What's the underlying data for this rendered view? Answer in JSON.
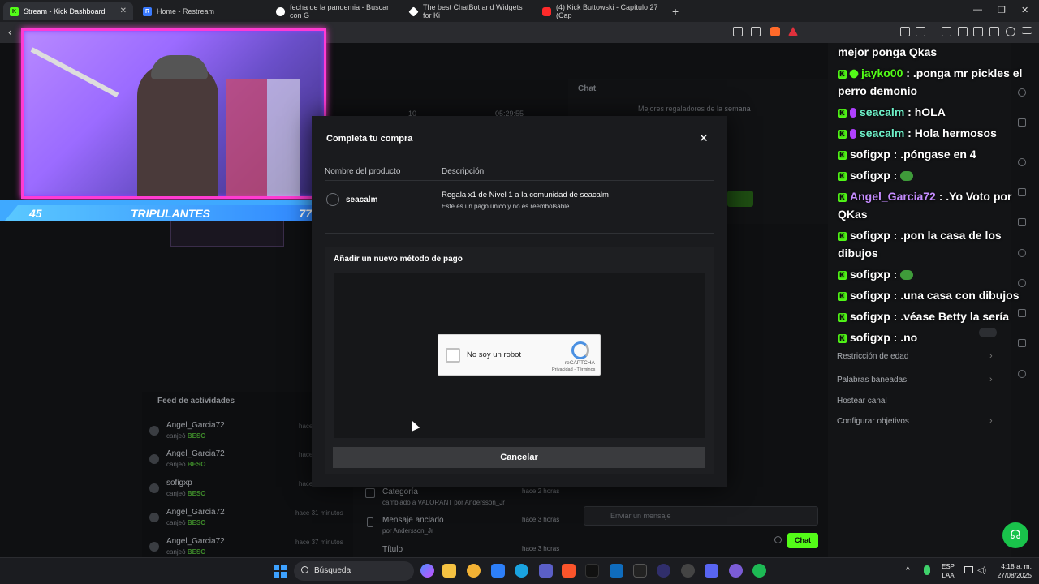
{
  "browser": {
    "tabs": [
      {
        "label": "Stream - Kick Dashboard",
        "active": true,
        "icon": "kick-icon"
      },
      {
        "label": "Home - Restream",
        "icon": "restream-icon"
      },
      {
        "label": "fecha de la pandemia - Buscar con G",
        "icon": "google-icon"
      },
      {
        "label": "The best ChatBot and Widgets for Ki",
        "icon": "botrix-icon"
      },
      {
        "label": "(4) Kick Buttowski - Capítulo 27 (Cap",
        "icon": "youtube-icon"
      }
    ]
  },
  "webcam": {
    "left_count": "45",
    "label": "TRIPULANTES",
    "right_count": "77"
  },
  "dashboard": {
    "chat_title": "Chat",
    "leaders_title": "Mejores regaladores de la semana",
    "stat1": "10",
    "stat2": "05:29:55",
    "feed_title": "Feed de actividades",
    "feed": [
      {
        "name": "Angel_Garcia72",
        "action": "canjeó",
        "item": "BESO",
        "time": "hace"
      },
      {
        "name": "Angel_Garcia72",
        "action": "canjeó",
        "item": "BESO",
        "time": "hace"
      },
      {
        "name": "sofigxp",
        "action": "canjeó",
        "item": "BESO",
        "time": "hace"
      },
      {
        "name": "Angel_Garcia72",
        "action": "canjeó",
        "item": "BESO",
        "time": "hace 31 minutos"
      },
      {
        "name": "Angel_Garcia72",
        "action": "canjeó",
        "item": "BESO",
        "time": "hace 37 minutos"
      }
    ],
    "events": [
      {
        "title": "Categoría",
        "sub": "cambiado a VALORANT por Andersson_Jr",
        "time": "hace 2 horas"
      },
      {
        "title": "Mensaje anclado",
        "sub": "por Andersson_Jr",
        "time": "hace 3 horas"
      },
      {
        "title": "Título",
        "time": "hace 3 horas"
      }
    ],
    "chat_input_placeholder": "Enviar un mensaje",
    "chat_button": "Chat"
  },
  "settings": [
    {
      "label": "Restricción de edad",
      "chevron": true
    },
    {
      "label": "Palabras baneadas",
      "chevron": true
    },
    {
      "label": "Hostear canal",
      "chevron": false
    },
    {
      "label": "Configurar objetivos",
      "chevron": true
    }
  ],
  "chat_overlay": [
    {
      "user": "",
      "text": "mejor ponga Qkas",
      "user_color": "#ffffff",
      "badge": "none"
    },
    {
      "user": "jayko00",
      "text": ": .ponga mr pickles el perro demonio",
      "user_color": "#53fc18",
      "badge": "sub-green"
    },
    {
      "user": "seacalm",
      "text": ": hOLA",
      "user_color": "#6ef0c8",
      "badge": "sub-purple"
    },
    {
      "user": "seacalm",
      "text": ": Hola hermosos",
      "user_color": "#6ef0c8",
      "badge": "sub-purple"
    },
    {
      "user": "sofigxp",
      "text": ": .póngase en 4",
      "user_color": "#ffffff",
      "badge": "kick"
    },
    {
      "user": "sofigxp",
      "text": ":",
      "user_color": "#ffffff",
      "badge": "kick",
      "emote": "frog-emote"
    },
    {
      "user": "Angel_Garcia72",
      "text": ": .Yo Voto por QKas",
      "user_color": "#c58cff",
      "badge": "kick"
    },
    {
      "user": "sofigxp",
      "text": ": .pon la casa de los dibujos",
      "user_color": "#ffffff",
      "badge": "kick"
    },
    {
      "user": "sofigxp",
      "text": ":",
      "user_color": "#ffffff",
      "badge": "kick",
      "emote": "frog-emote"
    },
    {
      "user": "sofigxp",
      "text": ": .una casa con dibujos",
      "user_color": "#ffffff",
      "badge": "kick"
    },
    {
      "user": "sofigxp",
      "text": ": .véase Betty la sería",
      "user_color": "#ffffff",
      "badge": "kick"
    },
    {
      "user": "sofigxp",
      "text": ": .no",
      "user_color": "#ffffff",
      "badge": "kick"
    }
  ],
  "modal": {
    "title": "Completa tu compra",
    "col_product": "Nombre del producto",
    "col_description": "Descripción",
    "product_name": "seacalm",
    "description": "Regala x1 de Nivel 1 a la comunidad de seacalm",
    "description_note": "Este es un pago único y no es reembolsable",
    "payment_title": "Añadir un nuevo método de pago",
    "captcha_label": "No soy un robot",
    "captcha_brand": "reCAPTCHA",
    "captcha_links": "Privacidad - Términos",
    "cancel_label": "Cancelar"
  },
  "taskbar": {
    "search_placeholder": "Búsqueda",
    "lang_top": "ESP",
    "lang_bottom": "LAA",
    "time": "4:18 a. m.",
    "date": "27/08/2025"
  },
  "colors": {
    "kick_green": "#53fc18",
    "accent_pink": "#ff3bd2",
    "accent_blue": "#3fa9ff"
  }
}
